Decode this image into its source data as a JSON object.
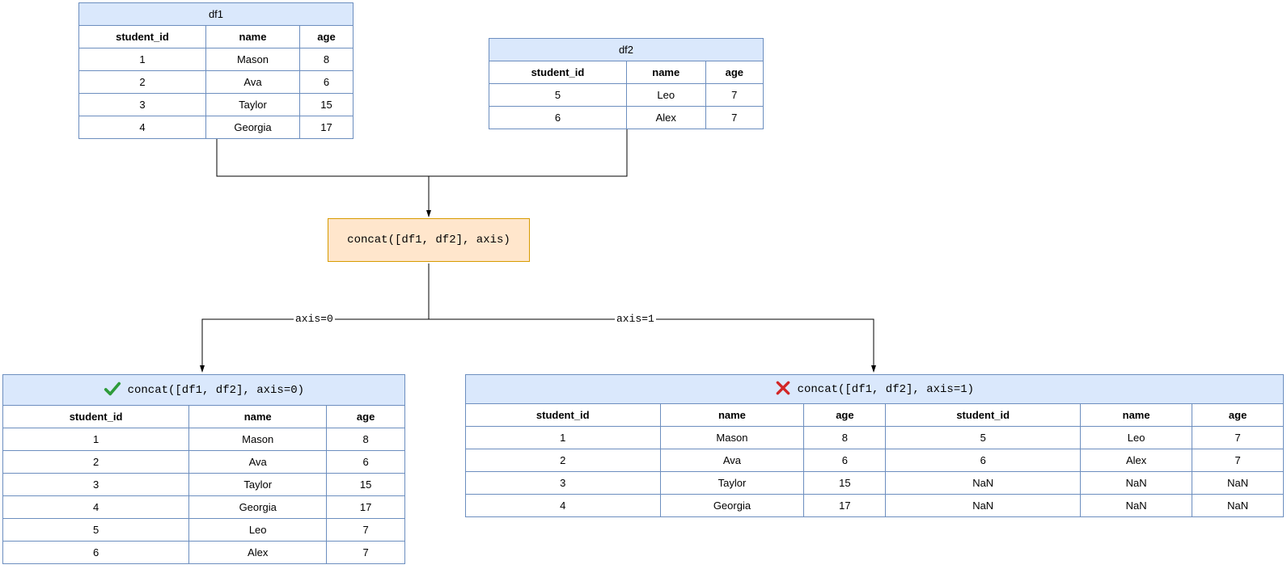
{
  "df1": {
    "title": "df1",
    "cols": [
      "student_id",
      "name",
      "age"
    ],
    "rows": [
      [
        "1",
        "Mason",
        "8"
      ],
      [
        "2",
        "Ava",
        "6"
      ],
      [
        "3",
        "Taylor",
        "15"
      ],
      [
        "4",
        "Georgia",
        "17"
      ]
    ]
  },
  "df2": {
    "title": "df2",
    "cols": [
      "student_id",
      "name",
      "age"
    ],
    "rows": [
      [
        "5",
        "Leo",
        "7"
      ],
      [
        "6",
        "Alex",
        "7"
      ]
    ]
  },
  "op": {
    "label": "concat([df1, df2], axis)"
  },
  "branch": {
    "left_label": "axis=0",
    "right_label": "axis=1"
  },
  "result0": {
    "title": "concat([df1, df2], axis=0)",
    "cols": [
      "student_id",
      "name",
      "age"
    ],
    "rows": [
      [
        "1",
        "Mason",
        "8"
      ],
      [
        "2",
        "Ava",
        "6"
      ],
      [
        "3",
        "Taylor",
        "15"
      ],
      [
        "4",
        "Georgia",
        "17"
      ],
      [
        "5",
        "Leo",
        "7"
      ],
      [
        "6",
        "Alex",
        "7"
      ]
    ]
  },
  "result1": {
    "title": "concat([df1, df2], axis=1)",
    "cols": [
      "student_id",
      "name",
      "age",
      "student_id",
      "name",
      "age"
    ],
    "rows": [
      [
        "1",
        "Mason",
        "8",
        "5",
        "Leo",
        "7"
      ],
      [
        "2",
        "Ava",
        "6",
        "6",
        "Alex",
        "7"
      ],
      [
        "3",
        "Taylor",
        "15",
        "NaN",
        "NaN",
        "NaN"
      ],
      [
        "4",
        "Georgia",
        "17",
        "NaN",
        "NaN",
        "NaN"
      ]
    ]
  }
}
